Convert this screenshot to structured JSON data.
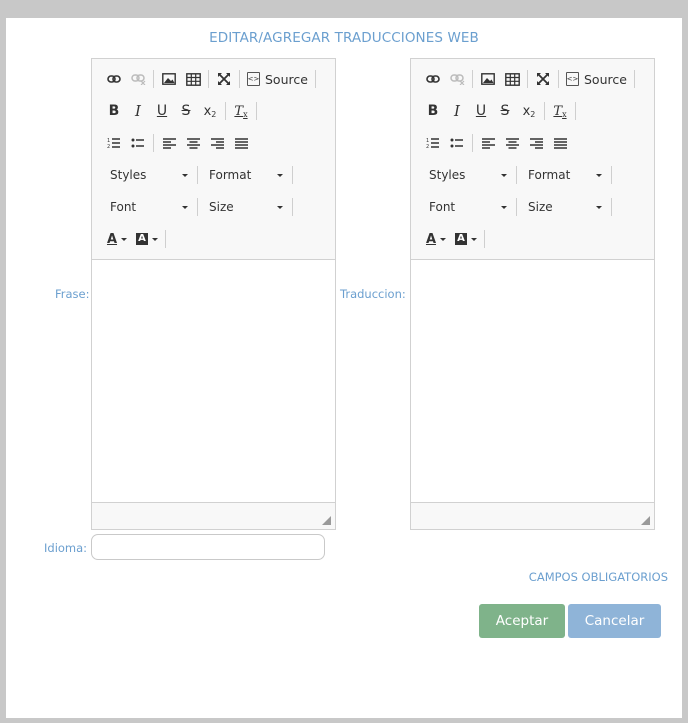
{
  "dialog": {
    "title": "EDITAR/AGREGAR TRADUCCIONES WEB",
    "fields": {
      "frase_label": "Frase:",
      "traduccion_label": "Traduccion:",
      "idioma_label": "Idioma:",
      "idioma_value": ""
    },
    "toolbar": {
      "source_label": "Source",
      "styles_label": "Styles",
      "format_label": "Format",
      "font_label": "Font",
      "size_label": "Size",
      "bold": "B",
      "italic": "I",
      "underline": "U",
      "strike": "S",
      "subscript_main": "x",
      "subscript_small": "2",
      "remove_format_main": "T",
      "remove_format_small": "x",
      "text_color": "A",
      "bg_color": "A"
    },
    "required_text": "CAMPOS OBLIGATORIOS",
    "buttons": {
      "accept": "Aceptar",
      "cancel": "Cancelar"
    }
  },
  "colors": {
    "accent": "#6b9fcf",
    "accept": "#7fb38a",
    "cancel": "#8fb4d8"
  }
}
